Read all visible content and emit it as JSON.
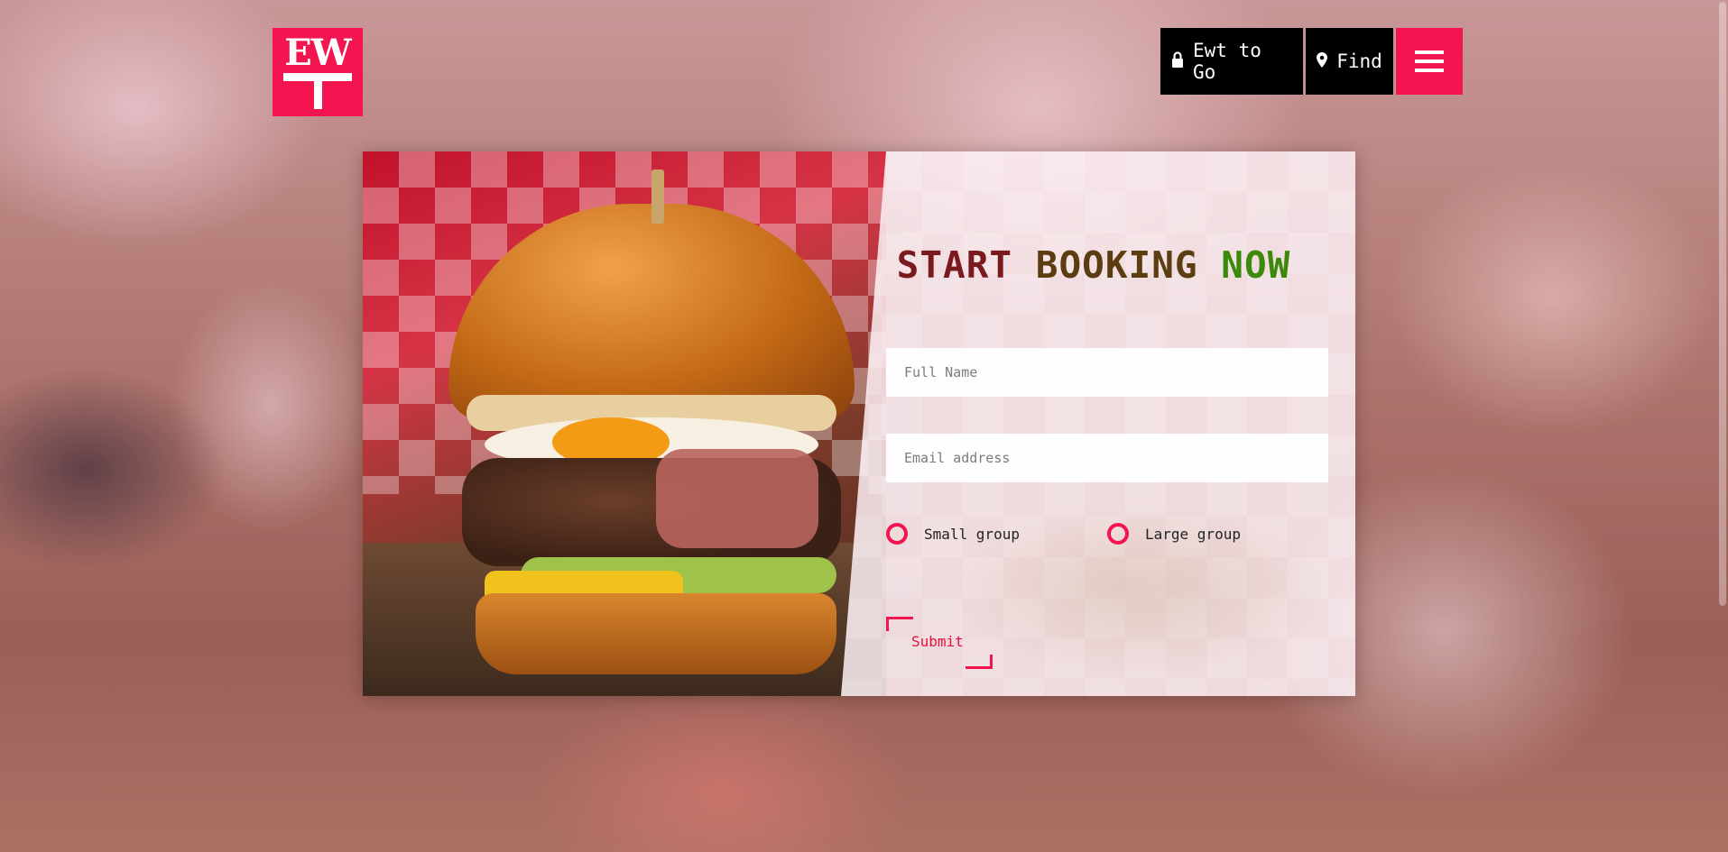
{
  "brand": {
    "logo_text": "EW",
    "accent_color": "#f3154f"
  },
  "nav": {
    "to_go_label": "Ewt to Go",
    "to_go_icon": "lock-icon",
    "find_label": "Find",
    "find_icon": "map-pin-icon",
    "menu_icon": "hamburger-menu-icon"
  },
  "booking": {
    "title_word_1": "START",
    "title_word_2": "BOOKING",
    "title_word_3": "NOW",
    "full_name_placeholder": "Full Name",
    "full_name_value": "",
    "email_placeholder": "Email address",
    "email_value": "",
    "options": [
      {
        "label": "Small group",
        "selected": false
      },
      {
        "label": "Large group",
        "selected": false
      }
    ],
    "submit_label": "Submit"
  }
}
